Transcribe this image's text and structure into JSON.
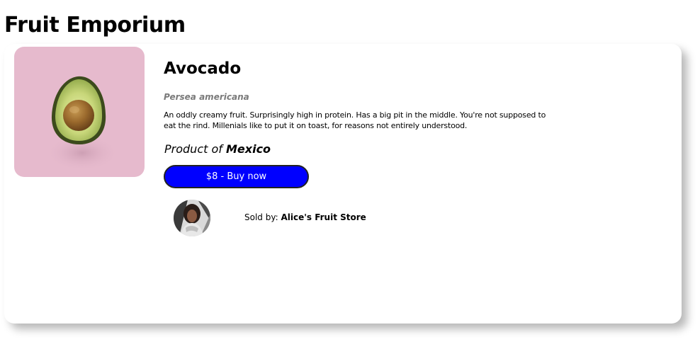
{
  "app": {
    "title": "Fruit Emporium"
  },
  "product": {
    "name": "Avocado",
    "image_icon": "avocado-image",
    "scientific_name": "Persea americana",
    "description": "An oddly creamy fruit. Surprisingly high in protein. Has a big pit in the middle. You're not supposed to eat the rind. Millenials like to put it on toast, for reasons not entirely understood.",
    "origin_prefix": "Product of ",
    "origin_country": "Mexico",
    "buy_label": "$8 - Buy now"
  },
  "seller": {
    "avatar_icon": "seller-avatar",
    "label": "Sold by: ",
    "store_name": "Alice's Fruit Store"
  },
  "colors": {
    "image_background": "#e6bacd",
    "buy_button": "#0000ff",
    "scientific_name": "#7a7a7a"
  }
}
